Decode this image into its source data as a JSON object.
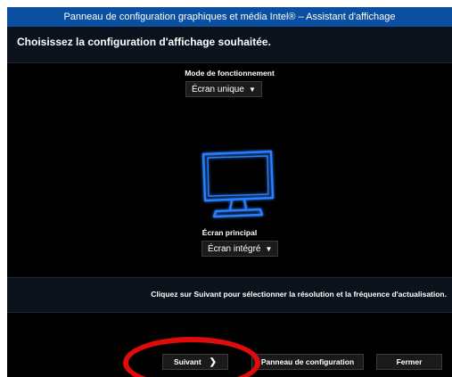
{
  "window": {
    "title": "Panneau de configuration graphiques et média Intel® – Assistant d'affichage"
  },
  "header": {
    "page_title": "Choisissez la configuration d'affichage souhaitée."
  },
  "mode": {
    "label": "Mode de fonctionnement",
    "selected": "Écran unique"
  },
  "display_icon": "monitor-icon",
  "primary": {
    "label": "Écran principal",
    "selected": "Écran intégré"
  },
  "hint": {
    "text": "Cliquez sur Suivant pour sélectionner la résolution et la fréquence d'actualisation."
  },
  "buttons": {
    "next_label": "Suivant",
    "control_panel_label": "Panneau de configuration",
    "close_label": "Fermer"
  },
  "colors": {
    "titlebar": "#0b4fa0",
    "background": "#000000",
    "monitor_glow": "#2a7fff",
    "annotation": "#e10b0b"
  }
}
